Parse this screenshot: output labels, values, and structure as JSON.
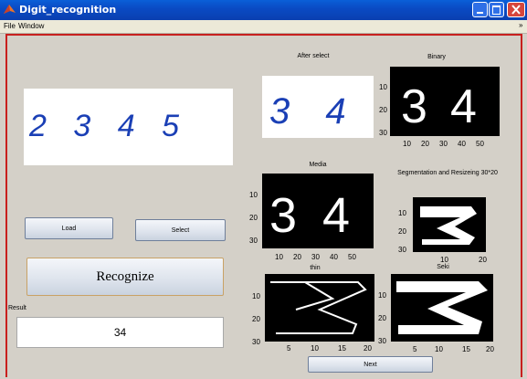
{
  "window": {
    "title": "Digit_recognition"
  },
  "menu": {
    "file": "File",
    "window": "Window"
  },
  "labels": {
    "after_select": "After select",
    "binary": "Binary",
    "media": "Media",
    "segmentation": "Segmentation and Resizeing 30*20",
    "thin": "thin",
    "seki": "Seki",
    "result": "Result"
  },
  "images": {
    "input_digits": "2 3 4 5",
    "selected_digits": "3 4"
  },
  "buttons": {
    "load": "Load",
    "select": "Select",
    "recognize": "Recognize",
    "next": "Next"
  },
  "result_value": "34",
  "axes": {
    "binary": {
      "x": [
        "10",
        "20",
        "30",
        "40",
        "50"
      ],
      "y": [
        "10",
        "20",
        "30"
      ]
    },
    "media": {
      "x": [
        "10",
        "20",
        "30",
        "40",
        "50"
      ],
      "y": [
        "10",
        "20",
        "30"
      ]
    },
    "segmentation": {
      "x": [
        "10",
        "20"
      ],
      "y": [
        "10",
        "20",
        "30"
      ]
    },
    "thin": {
      "x": [
        "5",
        "10",
        "15",
        "20"
      ],
      "y": [
        "10",
        "20",
        "30"
      ]
    },
    "seki": {
      "x": [
        "5",
        "10",
        "15",
        "20"
      ],
      "y": [
        "10",
        "20",
        "30"
      ]
    }
  },
  "colors": {
    "title_bar": "#0a4bc4",
    "frame_border": "#c8201e",
    "digit_ink": "#1a3fb5"
  }
}
